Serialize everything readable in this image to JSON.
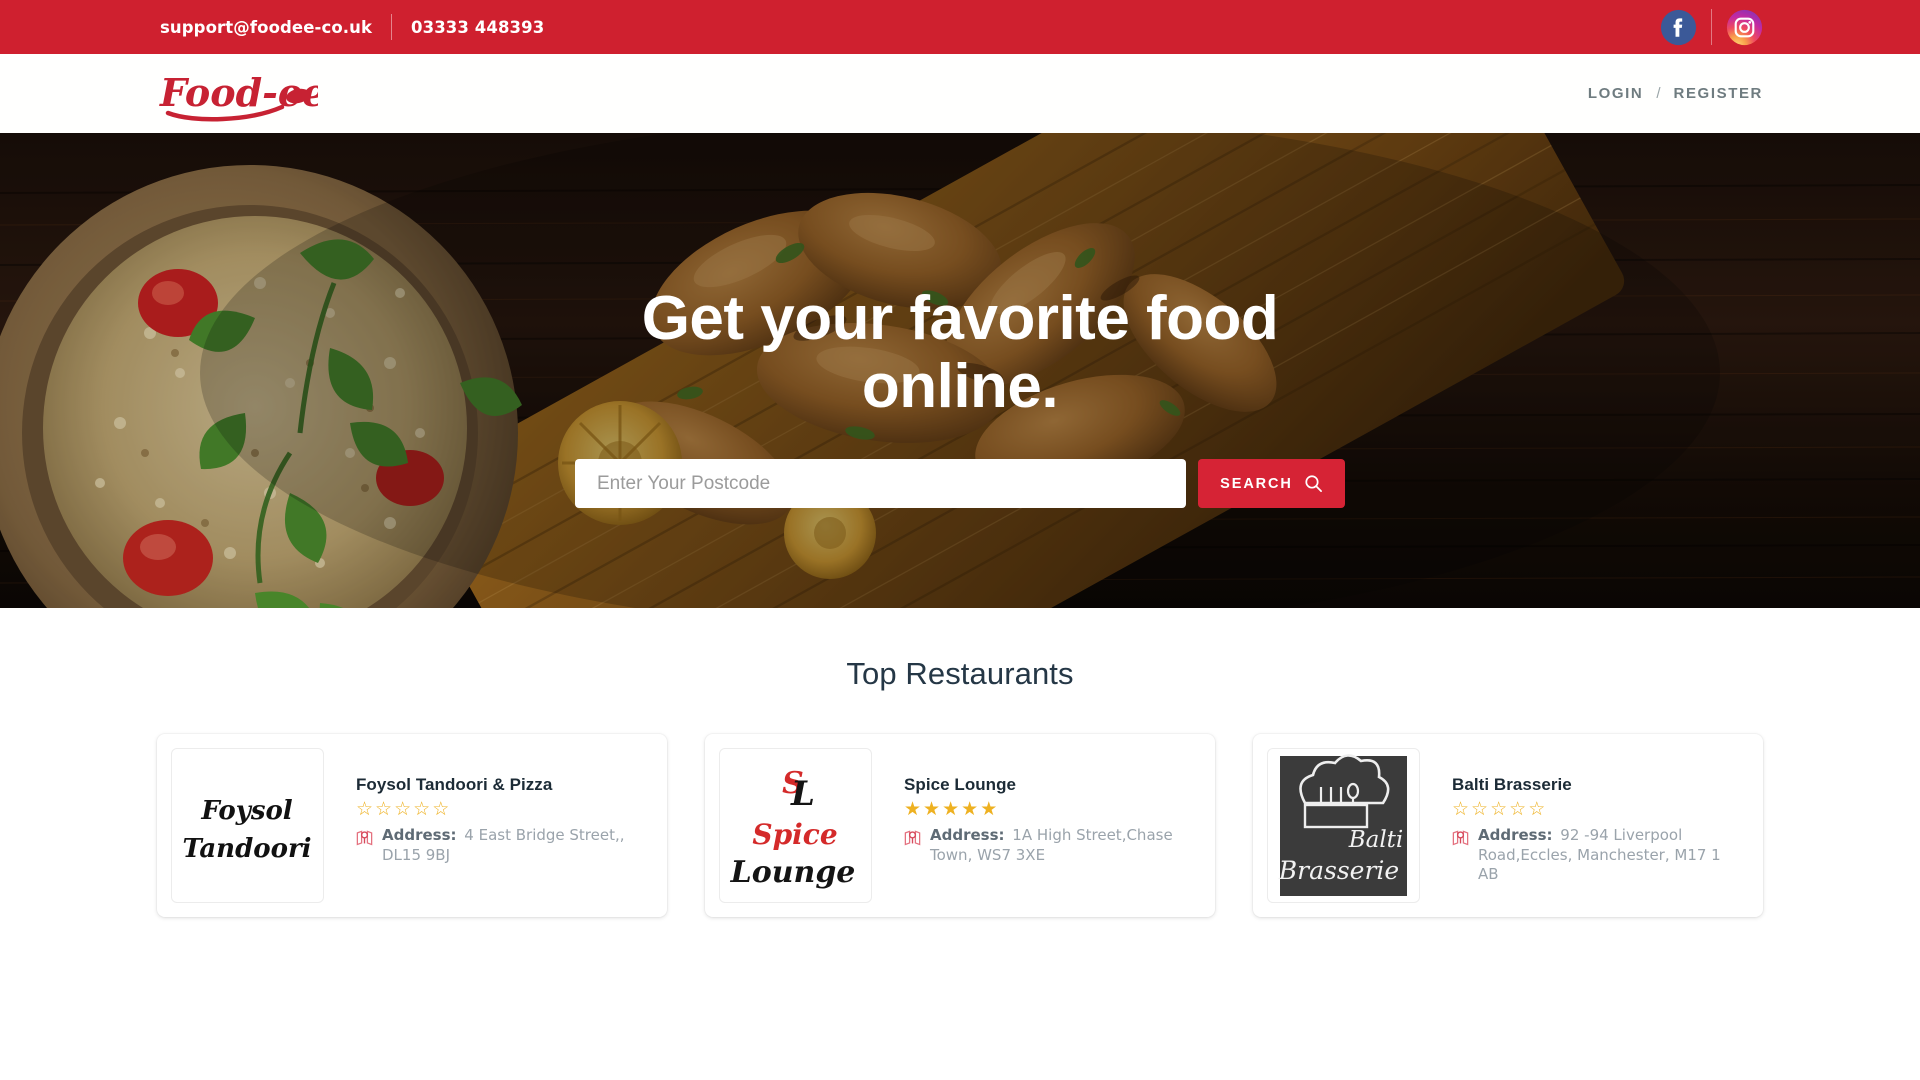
{
  "topbar": {
    "email": "support@foodee-co.uk",
    "phone": "03333 448393",
    "social": [
      {
        "name": "facebook-icon",
        "label": "Facebook"
      },
      {
        "name": "instagram-icon",
        "label": "Instagram"
      }
    ]
  },
  "header": {
    "logo_text": "Food-ee",
    "nav": {
      "login": "LOGIN",
      "separator": "/",
      "register": "REGISTER"
    }
  },
  "hero": {
    "title": "Get your favorite food online.",
    "search": {
      "value": "",
      "placeholder": "Enter Your Postcode",
      "button_label": "SEARCH",
      "button_icon": "search-icon",
      "button_color": "#d62335"
    }
  },
  "section": {
    "title": "Top Restaurants",
    "address_label": "Address:",
    "star_filled": "★",
    "star_empty": "☆",
    "restaurants": [
      {
        "name": "Foysol Tandoori & Pizza",
        "rating": 0,
        "max_rating": 5,
        "address": "4 East Bridge Street,, DL15 9BJ",
        "logo_text_line1": "Foysol",
        "logo_text_line2": "Tandoori",
        "logo_style": "light"
      },
      {
        "name": "Spice Lounge",
        "rating": 5,
        "max_rating": 5,
        "address": "1A High Street,Chase Town, WS7 3XE",
        "logo_text_line1": "Spice",
        "logo_text_line2": "Lounge",
        "logo_style": "light"
      },
      {
        "name": "Balti Brasserie",
        "rating": 0,
        "max_rating": 5,
        "address": "92 -94 Liverpool Road,Eccles, Manchester, M17 1 AB",
        "logo_text_line1": "Balti",
        "logo_text_line2": "Brasserie",
        "logo_style": "dark"
      }
    ]
  },
  "colors": {
    "brand_red": "#cf202f",
    "accent_red": "#d62335",
    "star_gold": "#eeb121",
    "nav_gray": "#6f7c80",
    "heading": "#253746"
  }
}
